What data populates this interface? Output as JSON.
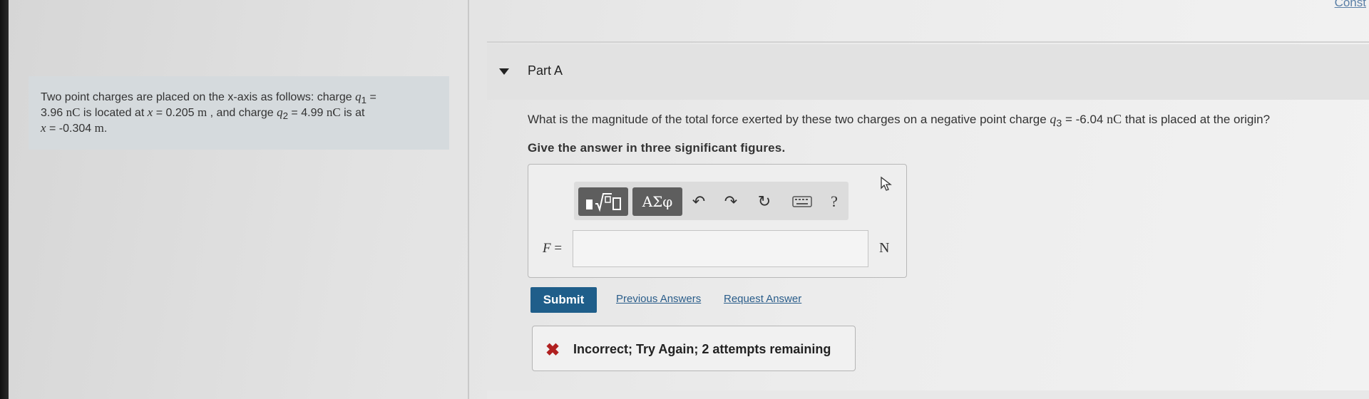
{
  "header": {
    "corner_link": "Const"
  },
  "problem": {
    "t1": "Two point charges are placed on the x-axis as follows: charge ",
    "q1_sym": "q",
    "q1_sub": "1",
    "t2": " =",
    "q1_val": "3.96",
    "t3": " is located at ",
    "x_sym": "x",
    "t4": " = 0.205 ",
    "u_m": "m",
    "t5": " , and charge ",
    "q2_sym": "q",
    "q2_sub": "2",
    "t6": " = 4.99 ",
    "u_nc": "nC",
    "t7": " is at",
    "x2_sym": "x",
    "t8": " = -0.304 ",
    "u_m2": "m",
    "t9": "."
  },
  "part": {
    "title": "Part A"
  },
  "question": {
    "t1": "What is the magnitude of the total force  exerted by these two charges on a negative point charge ",
    "q3_sym": "q",
    "q3_sub": "3",
    "t2": " = -6.04 ",
    "u_nc": "nC",
    "t3": " that is placed at the origin?",
    "instruction": "Give the answer in three significant figures."
  },
  "toolbar": {
    "templates_icon": "templates-icon",
    "greek_label": "ΑΣφ",
    "undo_icon": "↶",
    "redo_icon": "↷",
    "reset_icon": "↻",
    "keyboard_icon": "keyboard-icon",
    "help_label": "?"
  },
  "answer": {
    "variable": "F",
    "equals": " =",
    "value": "",
    "unit": "N"
  },
  "actions": {
    "submit": "Submit",
    "previous_answers": "Previous Answers",
    "request_answer": "Request Answer"
  },
  "feedback": {
    "icon": "✖",
    "message": "Incorrect; Try Again; 2 attempts remaining",
    "color": "#b02020"
  }
}
